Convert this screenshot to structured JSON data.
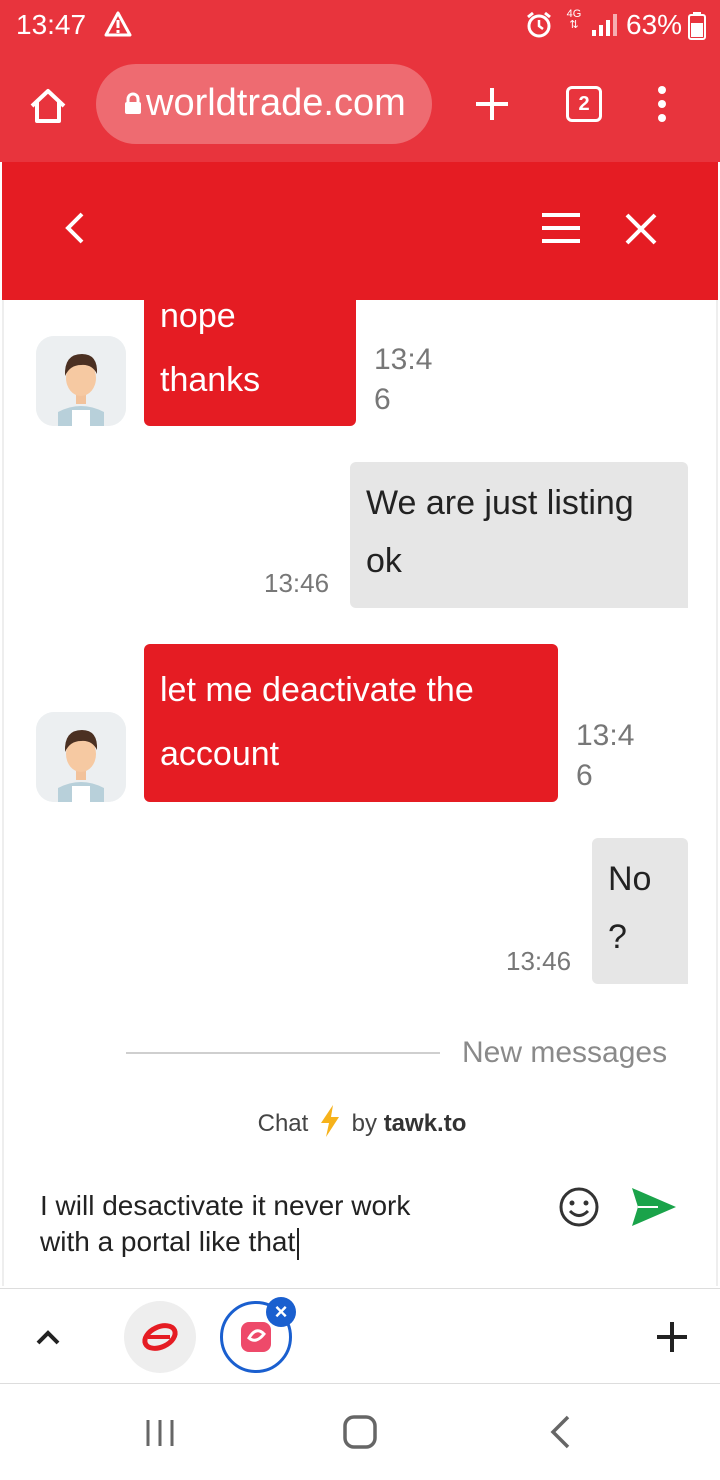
{
  "status_bar": {
    "time": "13:47",
    "network": "4G",
    "battery": "63%"
  },
  "browser": {
    "url": "worldtrade.com",
    "tab_count": "2"
  },
  "chat": {
    "messages": [
      {
        "from": "visitor",
        "lines": [
          "nope",
          "thanks"
        ],
        "time_lines": [
          "13:4",
          "6"
        ]
      },
      {
        "from": "agent",
        "lines": [
          "We are just listing",
          "ok"
        ],
        "time": "13:46"
      },
      {
        "from": "visitor",
        "lines": [
          "let me deactivate the",
          "account"
        ],
        "time_lines": [
          "13:4",
          "6"
        ]
      },
      {
        "from": "agent",
        "lines": [
          "No",
          "?"
        ],
        "time": "13:46"
      }
    ],
    "new_messages_label": "New messages",
    "powered_prefix": "Chat",
    "powered_by": "by",
    "powered_brand": "tawk.to",
    "composer_lines": [
      "I will desactivate it never work",
      "with a portal like that"
    ]
  },
  "colors": {
    "browser_red": "#e8343d",
    "chat_red": "#e51c23",
    "agent_bubble": "#e6e6e6",
    "send_green": "#1aa34a",
    "tab_blue": "#1a5fcf"
  }
}
